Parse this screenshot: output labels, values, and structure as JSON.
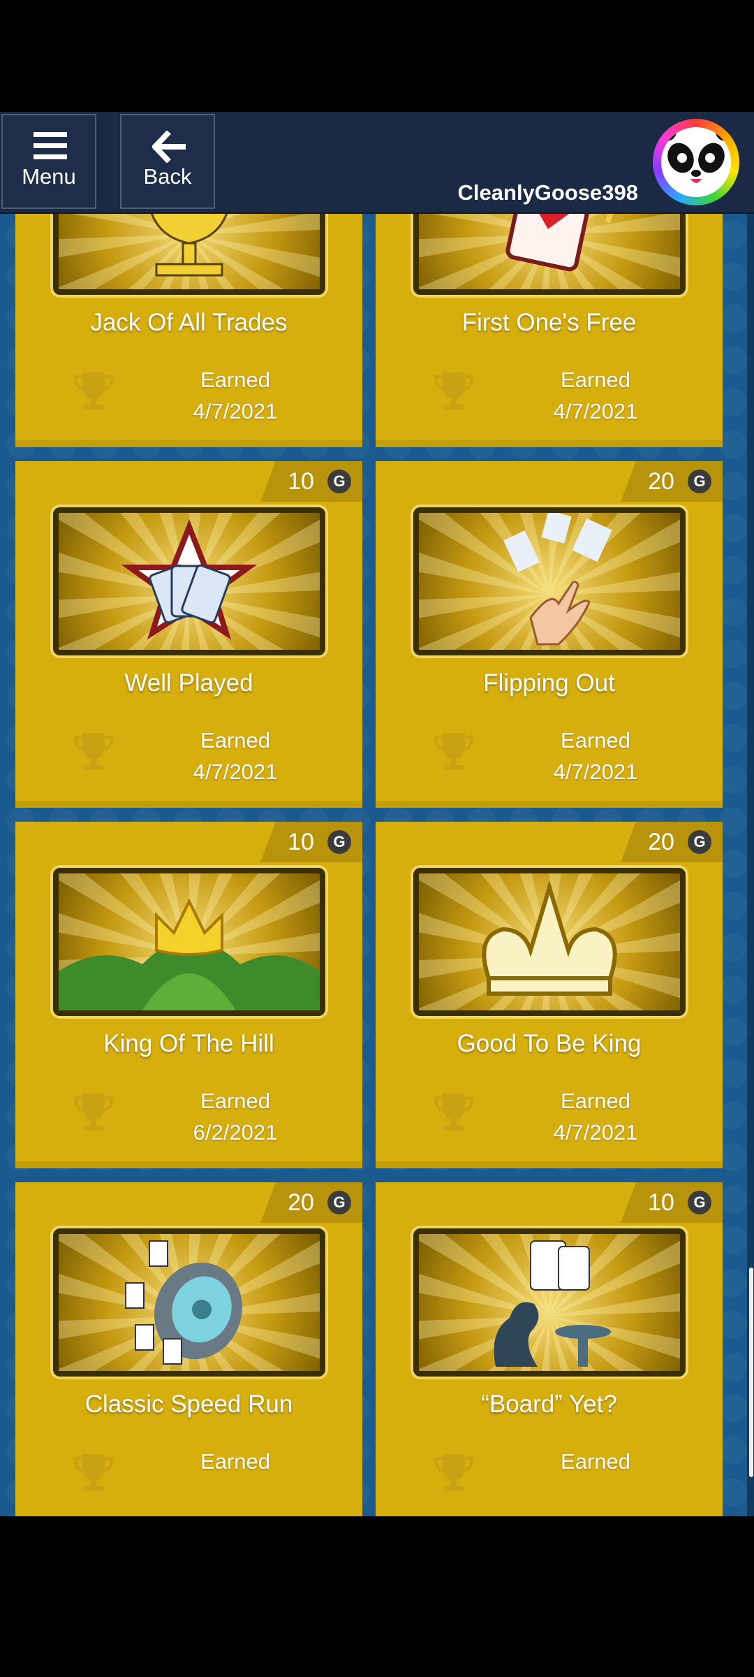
{
  "header": {
    "menu_label": "Menu",
    "back_label": "Back",
    "username": "CleanlyGoose398"
  },
  "achievements": [
    {
      "title": "Jack Of All Trades",
      "points": "",
      "earned_label": "Earned",
      "date": "4/7/2021",
      "icon": "goblet-icon"
    },
    {
      "title": "First One's Free",
      "points": "",
      "earned_label": "Earned",
      "date": "4/7/2021",
      "icon": "heart-card-icon"
    },
    {
      "title": "Well Played",
      "points": "10",
      "earned_label": "Earned",
      "date": "4/7/2021",
      "icon": "star-cards-icon"
    },
    {
      "title": "Flipping Out",
      "points": "20",
      "earned_label": "Earned",
      "date": "4/7/2021",
      "icon": "flipping-cards-icon"
    },
    {
      "title": "King Of The Hill",
      "points": "10",
      "earned_label": "Earned",
      "date": "6/2/2021",
      "icon": "crown-hill-icon"
    },
    {
      "title": "Good To Be King",
      "points": "20",
      "earned_label": "Earned",
      "date": "4/7/2021",
      "icon": "crown-icon"
    },
    {
      "title": "Classic Speed Run",
      "points": "20",
      "earned_label": "Earned",
      "date": "",
      "icon": "speed-wheel-icon"
    },
    {
      "title": "“Board” Yet?",
      "points": "10",
      "earned_label": "Earned",
      "date": "",
      "icon": "thinker-icon"
    }
  ],
  "gamerscore_symbol": "G",
  "colors": {
    "header_bg": "#1b2a44",
    "card_gold": "#d6ae0e",
    "background_blue": "#1a5a8f"
  }
}
